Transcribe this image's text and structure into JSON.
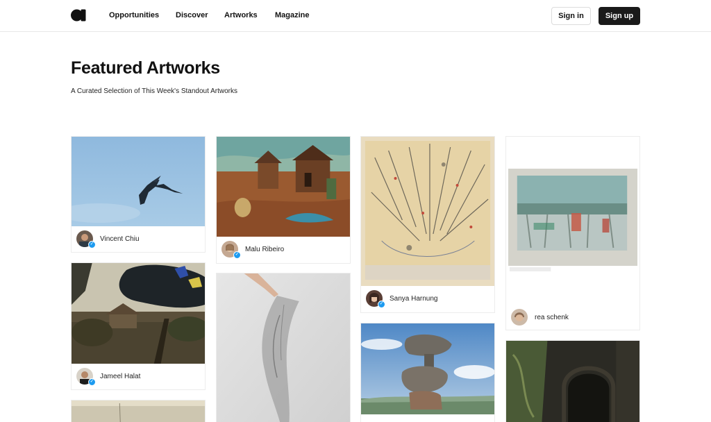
{
  "header": {
    "nav": [
      "Opportunities",
      "Discover",
      "Artworks",
      "Magazine"
    ],
    "sign_in": "Sign in",
    "sign_up": "Sign up"
  },
  "main": {
    "title": "Featured Artworks",
    "subtitle": "A Curated Selection of This Week's Standout Artworks"
  },
  "artworks": [
    {
      "artist": "Vincent Chiu",
      "verified": true
    },
    {
      "artist": "Jameel Halat",
      "verified": true
    },
    {
      "artist": "Malu Ribeiro",
      "verified": true
    },
    {
      "artist": "Sanya Harnung",
      "verified": true
    },
    {
      "artist": "rea schenk",
      "verified": false
    }
  ],
  "colors": {
    "verified_badge": "#1d9bf0",
    "primary_button": "#1a1a1a"
  }
}
